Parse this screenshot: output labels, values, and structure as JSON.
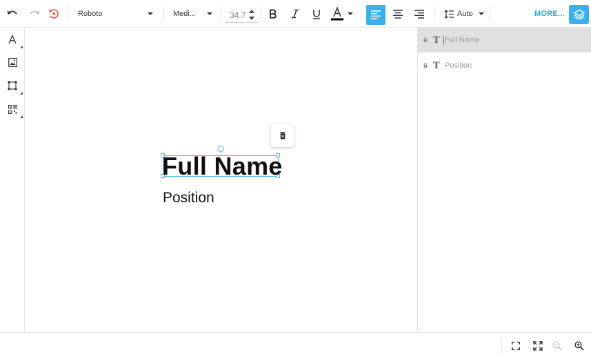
{
  "toolbar": {
    "font_family": "Roboto",
    "font_weight": "Medi...",
    "font_size": "34.7",
    "line_height": "Auto",
    "more_label": "MORE..."
  },
  "canvas": {
    "title_text": "Full Name",
    "position_text": "Position"
  },
  "layers": [
    {
      "name": "Full Name",
      "selected": true
    },
    {
      "name": "Position",
      "selected": false
    }
  ],
  "colors": {
    "accent": "#3bb0ef",
    "selection": "#4db8e8",
    "text_color_swatch": "#000000",
    "layer_selected_bg": "#e0e0e0"
  },
  "icons": {
    "toolbar": [
      "undo-icon",
      "redo-icon",
      "reset-icon",
      "bold-icon",
      "italic-icon",
      "underline-icon",
      "text-color-icon",
      "align-left-icon",
      "align-center-icon",
      "align-right-icon",
      "line-height-icon",
      "layers-icon"
    ],
    "left_tools": [
      "text-tool-icon",
      "image-tool-icon",
      "shape-tool-icon",
      "qr-code-icon"
    ],
    "bottom": [
      "fit-screen-icon",
      "fullscreen-icon",
      "zoom-out-icon",
      "zoom-in-icon"
    ]
  }
}
